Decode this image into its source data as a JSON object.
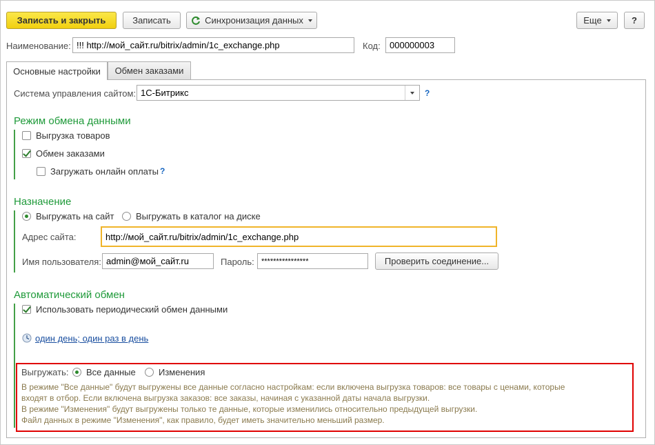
{
  "toolbar": {
    "save_close": "Записать и закрыть",
    "save": "Записать",
    "sync": "Синхронизация данных",
    "more": "Еще",
    "help": "?"
  },
  "header": {
    "name_label": "Наименование:",
    "name_value": "!!! http://мой_сайт.ru/bitrix/admin/1c_exchange.php",
    "code_label": "Код:",
    "code_value": "000000003"
  },
  "tabs": [
    {
      "label": "Основные настройки",
      "active": true
    },
    {
      "label": "Обмен заказами",
      "active": false
    }
  ],
  "cms": {
    "label": "Система управления сайтом:",
    "value": "1С-Битрикс",
    "help": "?"
  },
  "exchange_mode": {
    "title": "Режим обмена данными",
    "upload_goods": {
      "label": "Выгрузка товаров",
      "checked": false
    },
    "order_exchange": {
      "label": "Обмен заказами",
      "checked": true
    },
    "online_payments": {
      "label": "Загружать онлайн оплаты",
      "checked": false
    },
    "help": "?"
  },
  "destination": {
    "title": "Назначение",
    "to_site": {
      "label": "Выгружать на сайт",
      "selected": true
    },
    "to_disk": {
      "label": "Выгружать в каталог на диске",
      "selected": false
    },
    "address_label": "Адрес сайта:",
    "address_value": "http://мой_сайт.ru/bitrix/admin/1c_exchange.php",
    "user_label": "Имя пользователя:",
    "user_value": "admin@мой_сайт.ru",
    "password_label": "Пароль:",
    "password_value": "****************",
    "check_button": "Проверить соединение..."
  },
  "auto_exchange": {
    "title": "Автоматический обмен",
    "periodic": {
      "label": "Использовать периодический обмен данными",
      "checked": true
    },
    "schedule_link": "один день; один раз в день",
    "upload_label": "Выгружать:",
    "all_data": {
      "label": "Все данные",
      "selected": true
    },
    "changes": {
      "label": "Изменения",
      "selected": false
    },
    "notes": [
      "В режиме \"Все данные\" будут выгружены все данные согласно настройкам: если включена выгрузка товаров: все товары с ценами, которые",
      "входят в отбор. Если включена выгрузка заказов: все заказы, начиная с указанной даты начала выгрузки.",
      "В режиме \"Изменения\" будут выгружены только те данные, которые изменились относительно предыдущей выгрузки.",
      "Файл данных в режиме \"Изменения\", как правило, будет иметь значительно меньший размер."
    ]
  },
  "colors": {
    "accent_green": "#1f9a3a",
    "primary_button": "#f1cf0f",
    "highlight_border": "#e00000",
    "focus_border": "#f0b429",
    "note_text": "#8a7a4e"
  }
}
